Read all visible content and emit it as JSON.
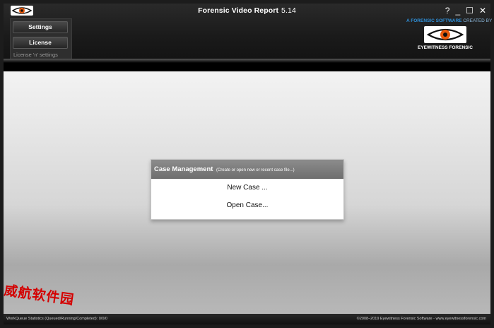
{
  "window": {
    "title": "Forensic Video Report",
    "version": "5.14",
    "controls": {
      "help": "?",
      "minimize": "_",
      "maximize": "☐",
      "close": "✕"
    }
  },
  "header": {
    "settings_button": "Settings",
    "license_button": "License",
    "panel_label": "License 'n' settings",
    "brand_top": "A FORENSIC SOFTWARE",
    "brand_top_small": "CREATED BY",
    "brand_name": "EYEWITNESS FORENSIC",
    "brand_color": "#2f8fd8",
    "eye_color": "#e85a0c"
  },
  "case_management": {
    "title": "Case Management",
    "subtitle": "(Create or open new or recent case file...)",
    "items": [
      "New Case ...",
      "Open Case..."
    ]
  },
  "watermark": "威航软件园",
  "status_bar": {
    "left_label": "WorkQueue Statistics (Queued/Running/Completed):",
    "left_value": "0/0/0",
    "right": "©2008–2019 Eyewitness Forensic Software - www.eyewitnessforensic.com"
  }
}
